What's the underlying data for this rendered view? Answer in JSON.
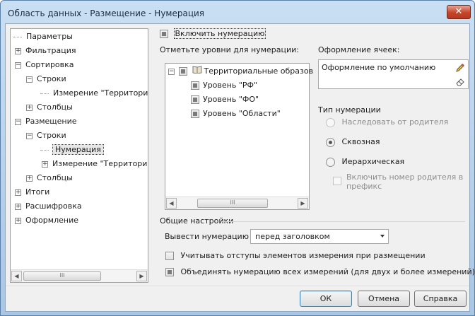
{
  "window": {
    "title": "Область данных - Размещение - Нумерация",
    "close_label": "✕"
  },
  "tree": {
    "items": [
      {
        "label": "Параметры"
      },
      {
        "label": "Фильтрация"
      },
      {
        "label": "Сортировка"
      },
      {
        "label": "Строки"
      },
      {
        "label": "Измерение \"Территориал"
      },
      {
        "label": "Столбцы"
      },
      {
        "label": "Размещение"
      },
      {
        "label": "Строки"
      },
      {
        "label": "Нумерация"
      },
      {
        "label": "Измерение \"Территориал"
      },
      {
        "label": "Столбцы"
      },
      {
        "label": "Итоги"
      },
      {
        "label": "Расшифровка"
      },
      {
        "label": "Оформление"
      }
    ],
    "scroll_left": "◀",
    "scroll_right": "▶",
    "thumb": "III"
  },
  "numbering": {
    "enable_label": "Включить нумерацию",
    "levels_label": "Отметьте уровни для нумерации:",
    "levels": [
      {
        "label": "Территориальные образов"
      },
      {
        "label": "Уровень \"РФ\""
      },
      {
        "label": "Уровень \"ФО\""
      },
      {
        "label": "Уровень \"Области\""
      }
    ],
    "cell_label": "Оформление ячеек:",
    "cell_value": "Оформление по умолчанию",
    "type_label": "Тип нумерации",
    "type_options": [
      {
        "label": "Наследовать от родителя"
      },
      {
        "label": "Сквозная"
      },
      {
        "label": "Иерархическая"
      }
    ],
    "parent_number_label": "Включить номер родителя в префикс"
  },
  "general": {
    "title": "Общие настройки",
    "output_label": "Вывести нумерацию",
    "output_value": "перед заголовком",
    "indent_label": "Учитывать отступы элементов измерения при размещении",
    "merge_label": "Объединять нумерацию всех измерений (для двух и более измерений)"
  },
  "buttons": {
    "ok": "ОК",
    "cancel": "Отмена",
    "help": "Справка"
  }
}
